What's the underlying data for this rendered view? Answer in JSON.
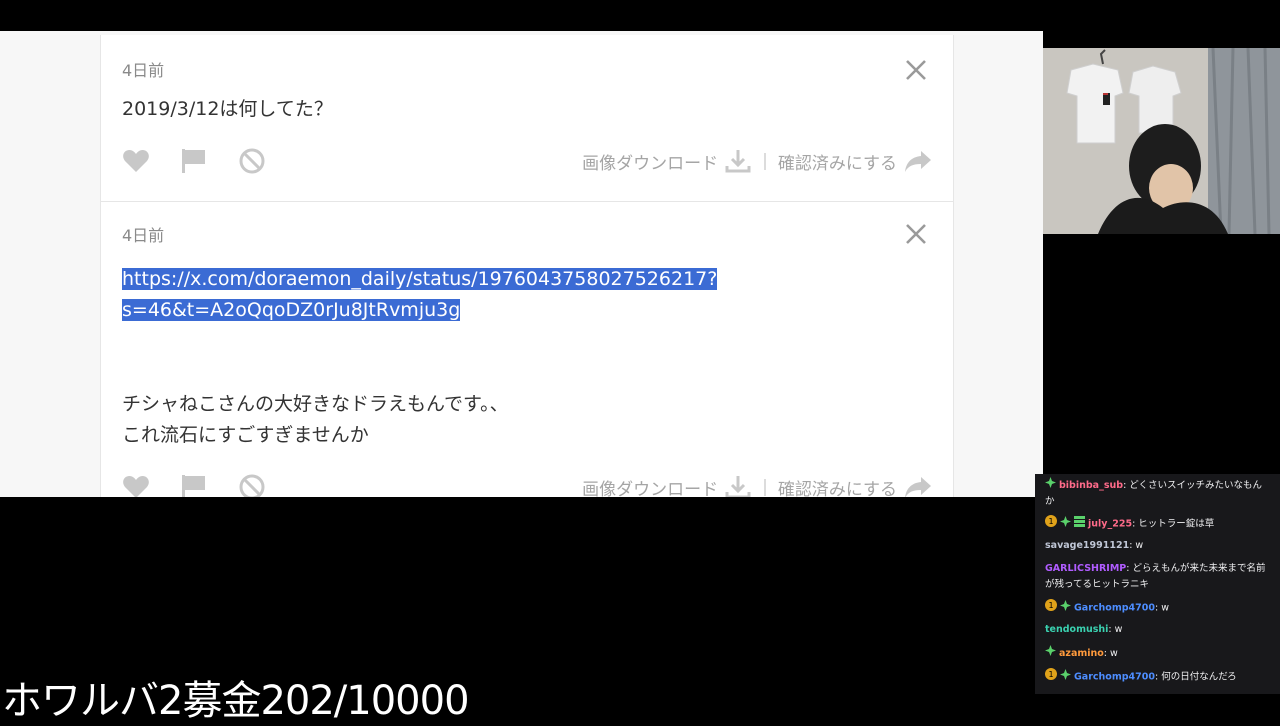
{
  "feed": {
    "cards": [
      {
        "time": "4日前",
        "question": "2019/3/12は何してた？",
        "download_label": "画像ダウンロード",
        "confirm_label": "確認済みにする"
      },
      {
        "time": "4日前",
        "link_line1": "https://x.com/doraemon_daily/status/1976043758027526217?",
        "link_line2": "s=46&t=A2oQqoDZ0rJu8JtRvmju3g",
        "body_line1": "チシャねこさんの大好きなドラえもんです。、",
        "body_line2": "これ流石にすごすぎませんか",
        "download_label": "画像ダウンロード",
        "confirm_label": "確認済みにする"
      }
    ],
    "separator": "|"
  },
  "chat": {
    "messages": [
      {
        "user": "bibinba_sub",
        "text": ": どくさいスイッチみたいなもん",
        "cont": "か",
        "color": "#ff6b8a"
      },
      {
        "user": "july_225",
        "text": ": ヒットラー錠は草",
        "color": "#ff6b8a"
      },
      {
        "user": "savage1991121",
        "text": ": w",
        "color": "#bfc6d6"
      },
      {
        "user": "GARLICSHRIMP",
        "text": ": どらえもんが来た未来まで名前",
        "cont": "が残ってるヒットラニキ",
        "color": "#b05cff"
      },
      {
        "user": "Garchomp4700",
        "text": ": w",
        "color": "#4d8dff"
      },
      {
        "user": "tendomushi",
        "text": ": w",
        "color": "#3ad1b0"
      },
      {
        "user": "azamino",
        "text": ": w",
        "color": "#ff9a3c"
      },
      {
        "user": "Garchomp4700",
        "text": ": 何の日付なんだろ",
        "color": "#4d8dff"
      }
    ]
  },
  "overlay": {
    "text": "ホワルバ2募金202/10000"
  },
  "icons": [
    "heart-icon",
    "flag-icon",
    "block-icon",
    "close-icon",
    "download-icon",
    "share-arrow-icon",
    "gift-badge-icon",
    "prime-badge-icon",
    "sub-badge-icon"
  ]
}
